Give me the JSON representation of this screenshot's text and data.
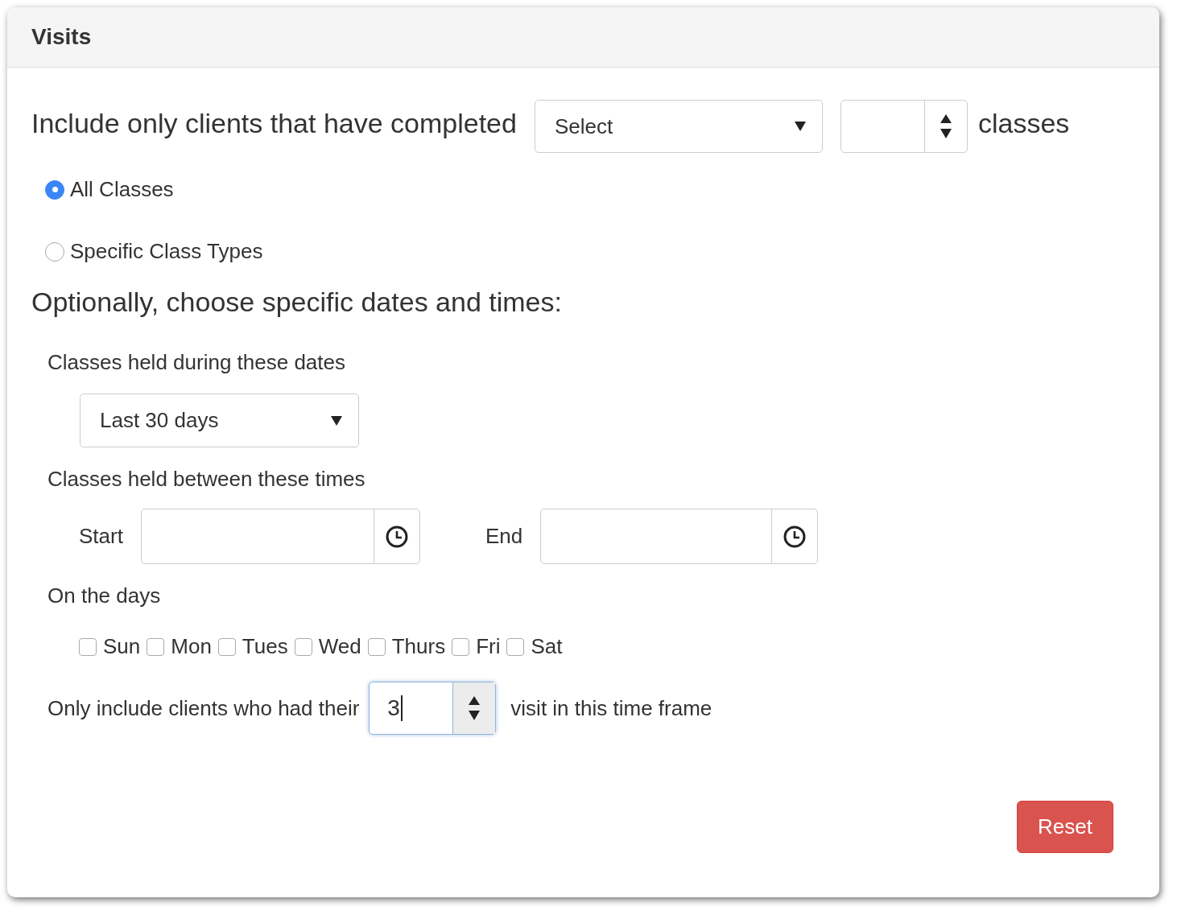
{
  "panel": {
    "title": "Visits"
  },
  "completed": {
    "label": "Include only clients that have completed",
    "select": {
      "value": "Select"
    },
    "unit": "classes"
  },
  "class_scope": [
    {
      "label": "All Classes",
      "selected": true
    },
    {
      "label": "Specific Class Types",
      "selected": false
    }
  ],
  "optional_heading": "Optionally, choose specific dates and times:",
  "dates": {
    "label": "Classes held during these dates",
    "select": {
      "value": "Last 30 days"
    }
  },
  "times": {
    "label": "Classes held between these times",
    "start": {
      "label": "Start"
    },
    "end": {
      "label": "End"
    }
  },
  "days": {
    "label": "On the days",
    "items": [
      {
        "label": "Sun",
        "checked": false
      },
      {
        "label": "Mon",
        "checked": false
      },
      {
        "label": "Tues",
        "checked": false
      },
      {
        "label": "Wed",
        "checked": false
      },
      {
        "label": "Thurs",
        "checked": false
      },
      {
        "label": "Fri",
        "checked": false
      },
      {
        "label": "Sat",
        "checked": false
      }
    ]
  },
  "visit": {
    "label_before": "Only include clients who had their",
    "value": "3",
    "focused": true,
    "label_after": "visit in this time frame"
  },
  "buttons": [
    {
      "label": "Reset",
      "kind": "danger"
    }
  ]
}
